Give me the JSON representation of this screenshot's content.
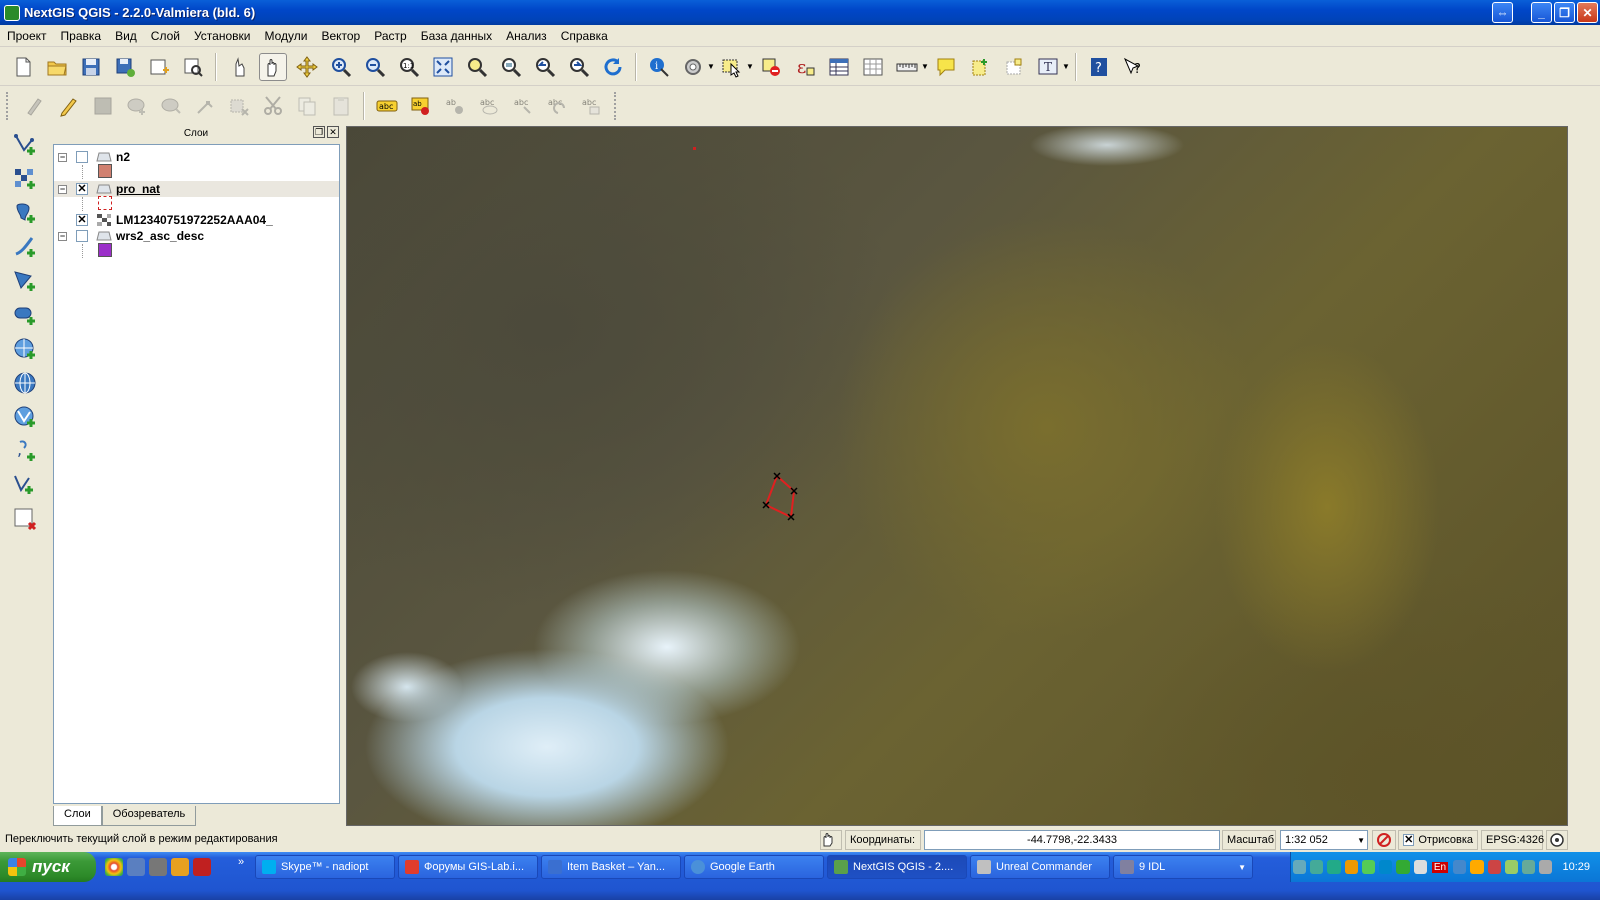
{
  "window": {
    "title": "NextGIS QGIS - 2.2.0-Valmiera (bld. 6)"
  },
  "menu": [
    "Проект",
    "Правка",
    "Вид",
    "Слой",
    "Установки",
    "Модули",
    "Вектор",
    "Растр",
    "База данных",
    "Анализ",
    "Справка"
  ],
  "layers_panel": {
    "title": "Слои",
    "layers": [
      {
        "name": "n2",
        "checked": false,
        "color": "#d08070"
      },
      {
        "name": "pro_nat",
        "checked": true,
        "color": "#ffffff"
      },
      {
        "name": "LM12340751972252AAA04_",
        "checked": true
      },
      {
        "name": "wrs2_asc_desc",
        "checked": false,
        "color": "#9b2fc9"
      }
    ],
    "checked_mark": "✕",
    "tabs": [
      "Слои",
      "Обозреватель"
    ]
  },
  "status": {
    "message": "Переключить текущий слой в режим редактирования",
    "coords_label": "Координаты:",
    "coords_value": "-44.7798,-22.3433",
    "scale_label": "Масштаб",
    "scale_value": "1:32 052",
    "render_label": "Отрисовка",
    "crs": "EPSG:4326"
  },
  "taskbar": {
    "start_label": "пуск",
    "tasks": [
      {
        "label": "Skype™ - nadiopt",
        "color": "#00aff0"
      },
      {
        "label": "Форумы GIS-Lab.i...",
        "color": "#e03c2c"
      },
      {
        "label": "Item Basket – Yan...",
        "color": "#3a6fd0"
      },
      {
        "label": "Google Earth",
        "color": "#4a90d9"
      },
      {
        "label": "NextGIS QGIS - 2....",
        "color": "#5aa04a"
      },
      {
        "label": "Unreal Commander",
        "color": "#c0c0c0"
      },
      {
        "label": "9 IDL",
        "color": "#8080a0"
      }
    ],
    "lang": "En",
    "time": "10:29"
  },
  "colors": {
    "selection_polygon": "#e02020",
    "titlebar": "#0046c8"
  }
}
